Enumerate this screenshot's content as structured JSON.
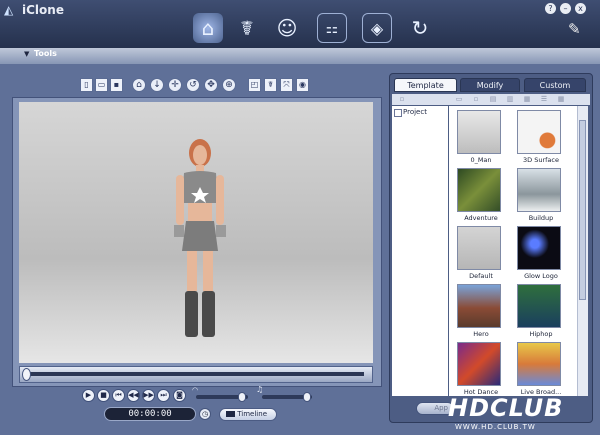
{
  "window": {
    "title": "iClone",
    "help_label": "?",
    "minimize_label": "–",
    "close_label": "x"
  },
  "toolbar": {
    "tools_label": "Tools"
  },
  "timeline": {
    "current_time": "00:00:00",
    "timeline_label": "Timeline"
  },
  "panel": {
    "tabs": [
      {
        "label": "Template"
      },
      {
        "label": "Modify"
      },
      {
        "label": "Custom"
      }
    ],
    "tree": {
      "project_label": "Project"
    },
    "templates": [
      {
        "label": "0_Man"
      },
      {
        "label": "3D Surface"
      },
      {
        "label": "Adventure"
      },
      {
        "label": "Buildup"
      },
      {
        "label": "Default"
      },
      {
        "label": "Glow Logo"
      },
      {
        "label": "Hero"
      },
      {
        "label": "Hiphop"
      },
      {
        "label": "Hot Dance"
      },
      {
        "label": "Live Broad..."
      }
    ],
    "apply_label": "App"
  },
  "watermark": {
    "logo": "HDCLUB",
    "url": "WWW.HD.CLUB.TW"
  },
  "colors": {
    "chrome": "#5f7098",
    "titlebar": "#25314d",
    "viewport_bg": "#c9c9c9",
    "panel": "#4d5d84"
  }
}
